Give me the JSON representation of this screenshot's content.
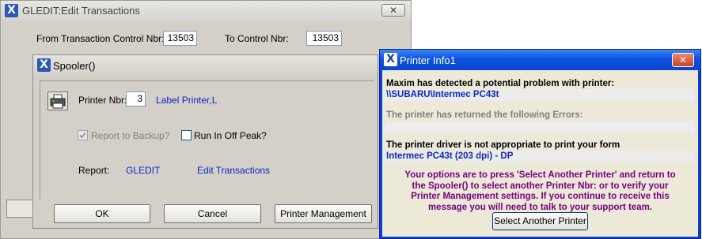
{
  "gledit": {
    "title": "GLEDIT:Edit Transactions",
    "from_label": "From Transaction Control Nbr:",
    "from_value": "13503",
    "to_label": "To Control Nbr:",
    "to_value": "13503",
    "close_glyph": "✕"
  },
  "spooler": {
    "title": "Spooler()",
    "printer_nbr_label": "Printer Nbr:",
    "printer_nbr_value": "3",
    "printer_name": "Label Printer,L",
    "report_backup_label": "Report to Backup?",
    "run_offpeak_label": "Run In Off Peak?",
    "report_label": "Report:",
    "report_code": "GLEDIT",
    "report_name": "Edit Transactions",
    "ok_label": "OK",
    "cancel_label": "Cancel",
    "printer_mgmt_label": "Printer Management"
  },
  "printer_info": {
    "title": "Printer Info1",
    "problem_heading": "Maxim has detected a potential problem with printer:",
    "printer_path": "\\\\SUBARU\\Intermec PC43t",
    "errors_heading": "The printer has returned the following Errors:",
    "driver_heading": "The printer driver is not appropriate to print your form",
    "driver_name": "Intermec PC43t (203 dpi) - DP",
    "options_lines": [
      "Your options are to press 'Select Another Printer' and return to",
      "the Spooler() to select another Printer Nbr: or to verify your",
      "Printer Management settings. If you continue to receive this",
      "message you will need to talk to your support team."
    ],
    "select_printer_label": "Select Another Printer"
  },
  "colors": {
    "xp_title": "#0a246a",
    "link_blue": "#0a28c8",
    "message_purple": "#7a0080",
    "close_red": "#d24b2b"
  }
}
